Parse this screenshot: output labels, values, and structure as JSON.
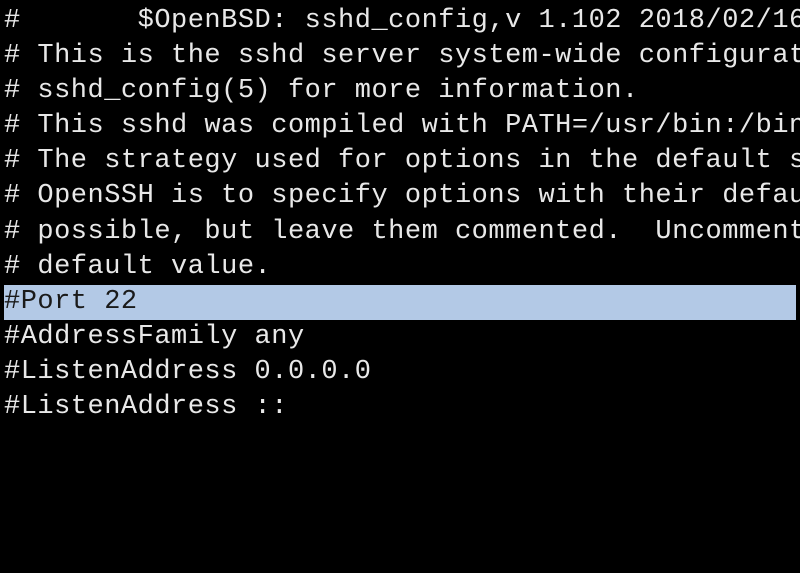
{
  "lines": {
    "l0": "#       $OpenBSD: sshd_config,v 1.102 2018/02/16 ",
    "l1": "",
    "l2": "# This is the sshd server system-wide configurati",
    "l3": "# sshd_config(5) for more information.",
    "l4": "",
    "l5": "# This sshd was compiled with PATH=/usr/bin:/bin:",
    "l6": "",
    "l7": "# The strategy used for options in the default ss",
    "l8": "# OpenSSH is to specify options with their defaul",
    "l9": "# possible, but leave them commented.  Uncommente",
    "l10": "# default value.",
    "l11": "",
    "l12": "#Port 22",
    "l13": "#AddressFamily any",
    "l14": "#ListenAddress 0.0.0.0",
    "l15": "#ListenAddress ::"
  }
}
